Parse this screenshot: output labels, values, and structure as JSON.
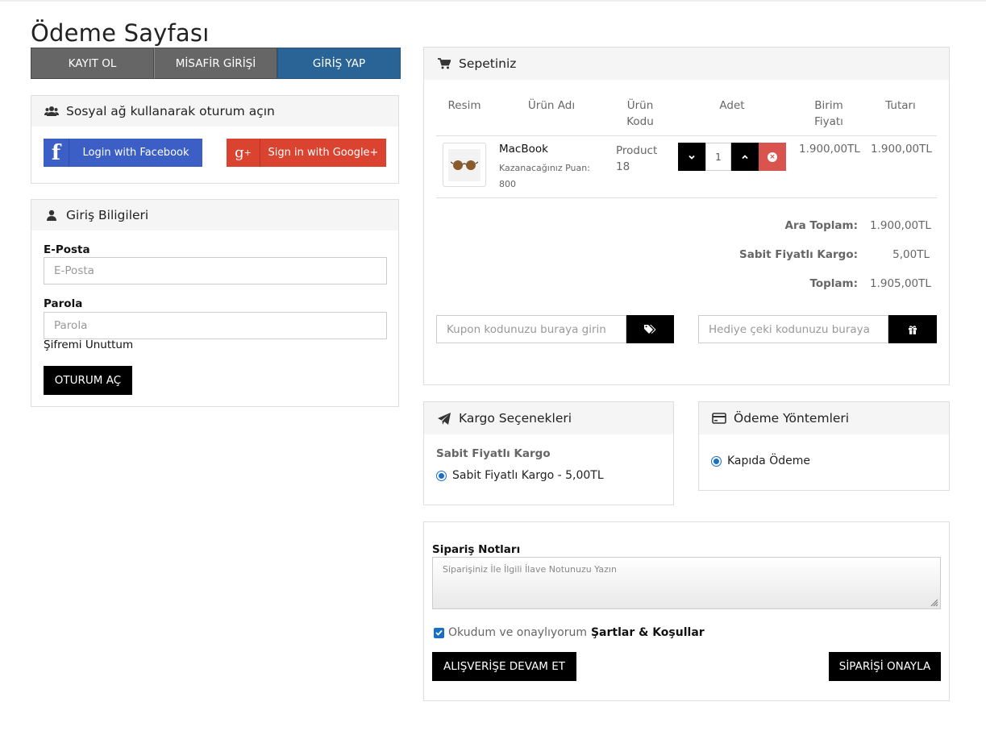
{
  "page": {
    "title": "Ödeme Sayfası"
  },
  "tabs": [
    {
      "label": "KAYIT OL"
    },
    {
      "label": "MİSAFİR GİRİŞİ"
    },
    {
      "label": "GİRİŞ YAP"
    }
  ],
  "social": {
    "title": "Sosyal ağ kullanarak oturum açın",
    "facebook_label": "Login with Facebook",
    "google_label": "Sign in with Google+"
  },
  "login": {
    "title": "Giriş Biligileri",
    "email_label": "E-Posta",
    "email_placeholder": "E-Posta",
    "password_label": "Parola",
    "password_placeholder": "Parola",
    "forgot": "Şifremi Unuttum",
    "submit": "OTURUM AÇ"
  },
  "cart": {
    "title": "Sepetiniz",
    "headers": {
      "image": "Resim",
      "name": "Ürün Adı",
      "code": "Ürün Kodu",
      "qty": "Adet",
      "unit": "Birim Fiyatı",
      "total": "Tutarı"
    },
    "items": [
      {
        "name": "MacBook",
        "points": "Kazanacağınız Puan: 800",
        "code": "Product 18",
        "qty": "1",
        "unit_price": "1.900,00TL",
        "total": "1.900,00TL"
      }
    ],
    "summary": [
      {
        "label": "Ara Toplam:",
        "value": "1.900,00TL"
      },
      {
        "label": "Sabit Fiyatlı Kargo:",
        "value": "5,00TL"
      },
      {
        "label": "Toplam:",
        "value": "1.905,00TL"
      }
    ],
    "coupon_placeholder": "Kupon kodunuzu buraya girin",
    "gift_placeholder": "Hediye çeki kodunuzu buraya"
  },
  "shipping": {
    "title": "Kargo Seçenekleri",
    "group": "Sabit Fiyatlı Kargo",
    "option": "Sabit Fiyatlı Kargo - 5,00TL"
  },
  "payment": {
    "title": "Ödeme Yöntemleri",
    "option": "Kapıda Ödeme"
  },
  "notes": {
    "label": "Sipariş Notları",
    "placeholder": "Siparişiniz İle İlgili İlave Notunuzu Yazın",
    "agree_text": "Okudum ve onaylıyorum",
    "terms": "Şartlar & Koşullar",
    "continue": "ALIŞVERİŞE DEVAM ET",
    "confirm": "SİPARİŞİ ONAYLA"
  },
  "colors": {
    "accent_blue": "#2a6496",
    "facebook": "#3b5fc4",
    "google": "#d9432f",
    "remove_red": "#d9534f",
    "radio_blue": "#1a6fc4"
  }
}
